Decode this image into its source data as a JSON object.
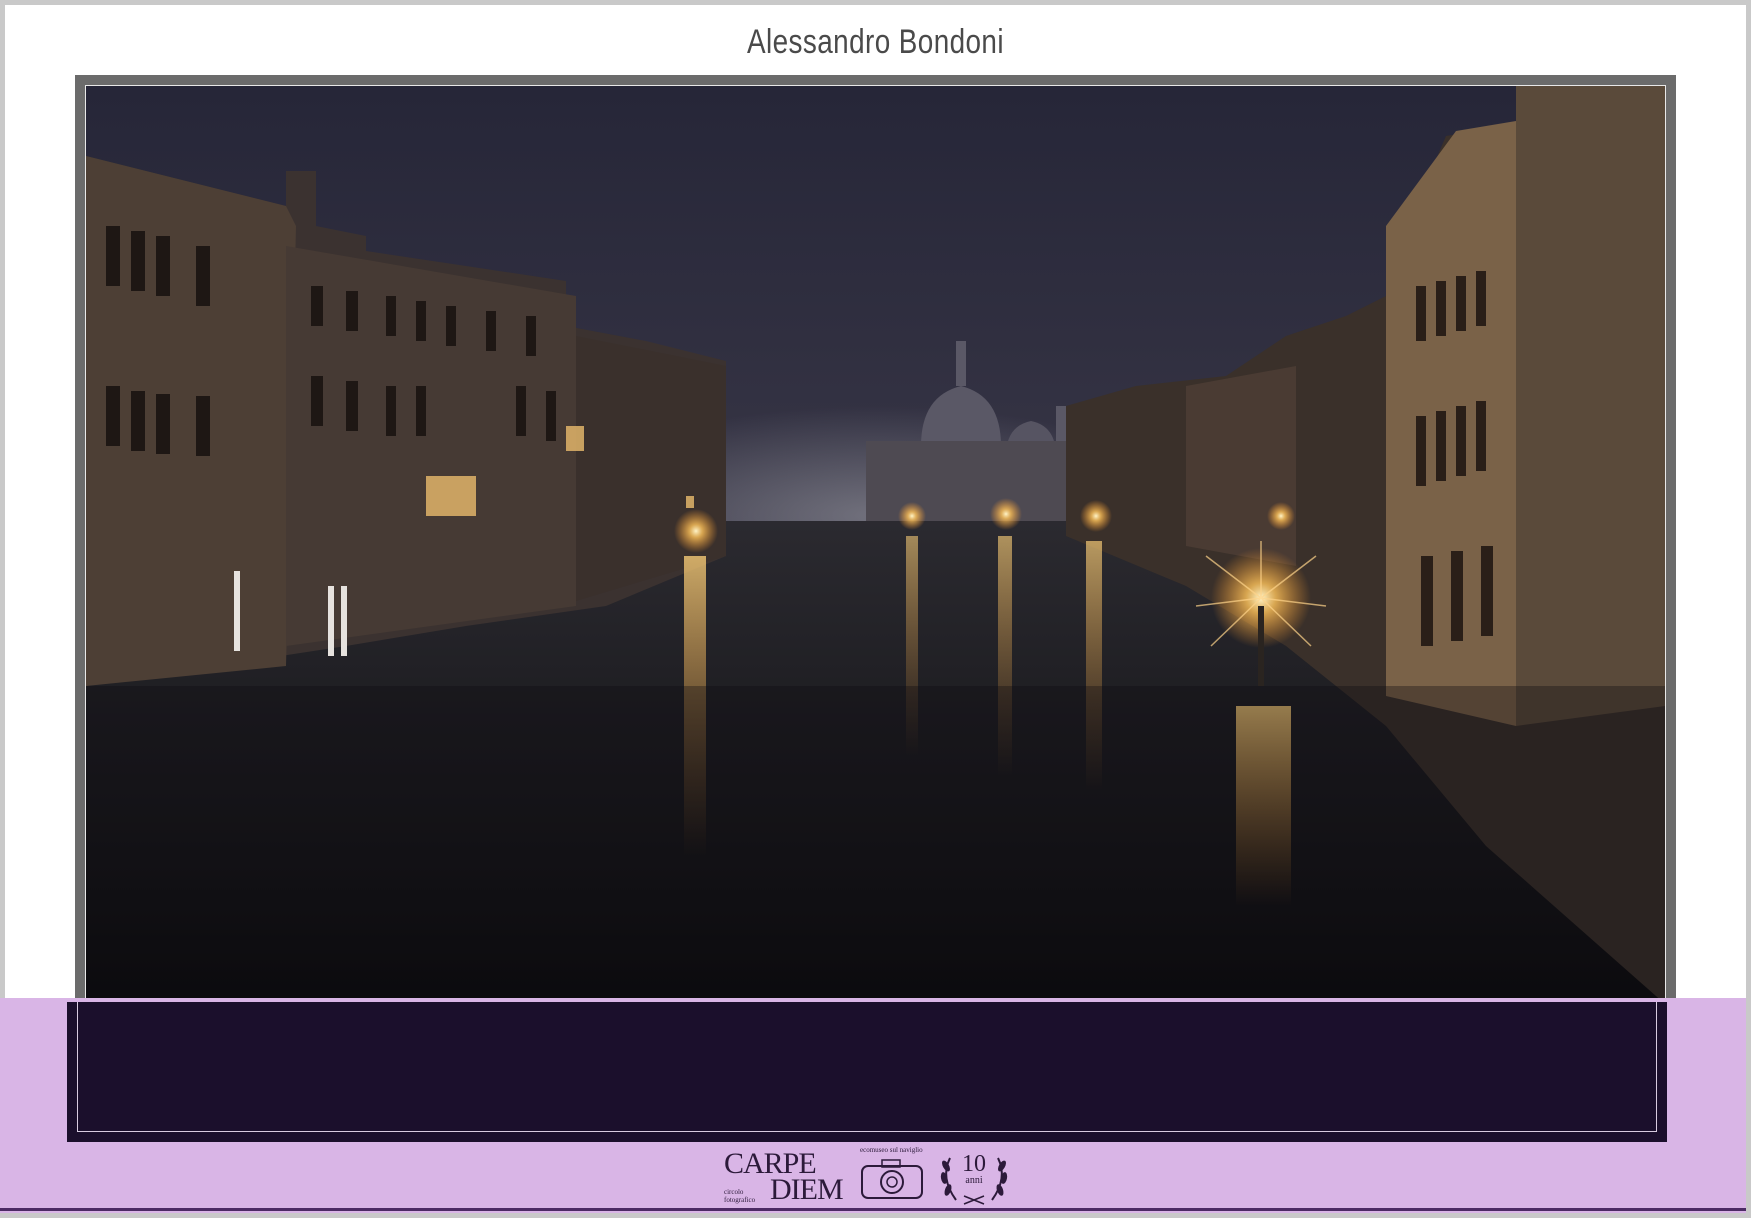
{
  "author": "Alessandro Bondoni",
  "logo": {
    "line1": "CARPE",
    "line2": "DIEM",
    "tagline": "ecomuseo sul naviglio",
    "club": "circolo fotografico",
    "anniversary_number": "10",
    "anniversary_word": "anni"
  },
  "colors": {
    "page": "#ffffff",
    "border": "#c9c9c9",
    "band": "#d9b5e6",
    "band_dark": "#1b0f2c"
  }
}
